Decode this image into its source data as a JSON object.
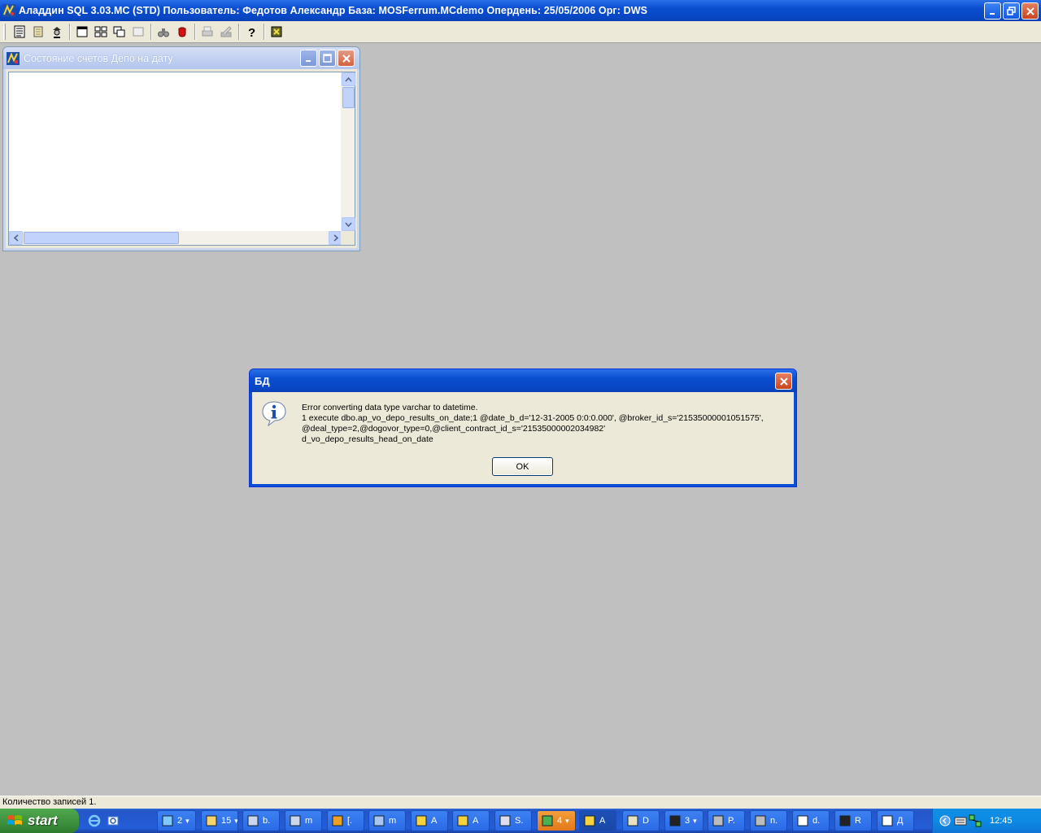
{
  "app": {
    "title": "Аладдин SQL 3.03.MC (STD)  Пользователь: Федотов Александр База: MOSFerrum.MCdemo Опердень: 25/05/2006 Орг: DWS"
  },
  "toolbar": {
    "icons": [
      "notes-icon",
      "database-icon",
      "wizard-icon",
      "window-icon",
      "tile-icon",
      "cascade-icon",
      "disabled-window-icon",
      "binoculars-icon",
      "stop-hand-icon",
      "print-icon",
      "edit-icon",
      "help-icon",
      "plugin-icon"
    ]
  },
  "child_window": {
    "title": "Состояние счетов Депо на дату"
  },
  "dialog": {
    "title": "БД",
    "message_line1": "Error converting data type varchar to datetime.",
    "message_line2": "1 execute dbo.ap_vo_depo_results_on_date;1 @date_b_d='12-31-2005 0:0:0.000', @broker_id_s='21535000001051575',",
    "message_line3": "@deal_type=2,@dogovor_type=0,@client_contract_id_s='21535000002034982'",
    "message_line4": "d_vo_depo_results_head_on_date",
    "ok_label": "OK"
  },
  "statusbar": {
    "text": "Количество записей 1."
  },
  "taskbar": {
    "start_label": "start",
    "tasks": [
      {
        "label": "2",
        "dropdown": true
      },
      {
        "label": "15",
        "dropdown": true
      },
      {
        "label": "b."
      },
      {
        "label": "m"
      },
      {
        "label": "[."
      },
      {
        "label": "m"
      },
      {
        "label": "A"
      },
      {
        "label": "A"
      },
      {
        "label": "S."
      },
      {
        "label": "4",
        "dropdown": true
      },
      {
        "label": "A"
      },
      {
        "label": "D"
      },
      {
        "label": "3",
        "dropdown": true
      },
      {
        "label": "P."
      },
      {
        "label": "n."
      },
      {
        "label": "d."
      },
      {
        "label": "R"
      },
      {
        "label": "Д"
      }
    ],
    "language": "EN",
    "clock": "12:45"
  }
}
